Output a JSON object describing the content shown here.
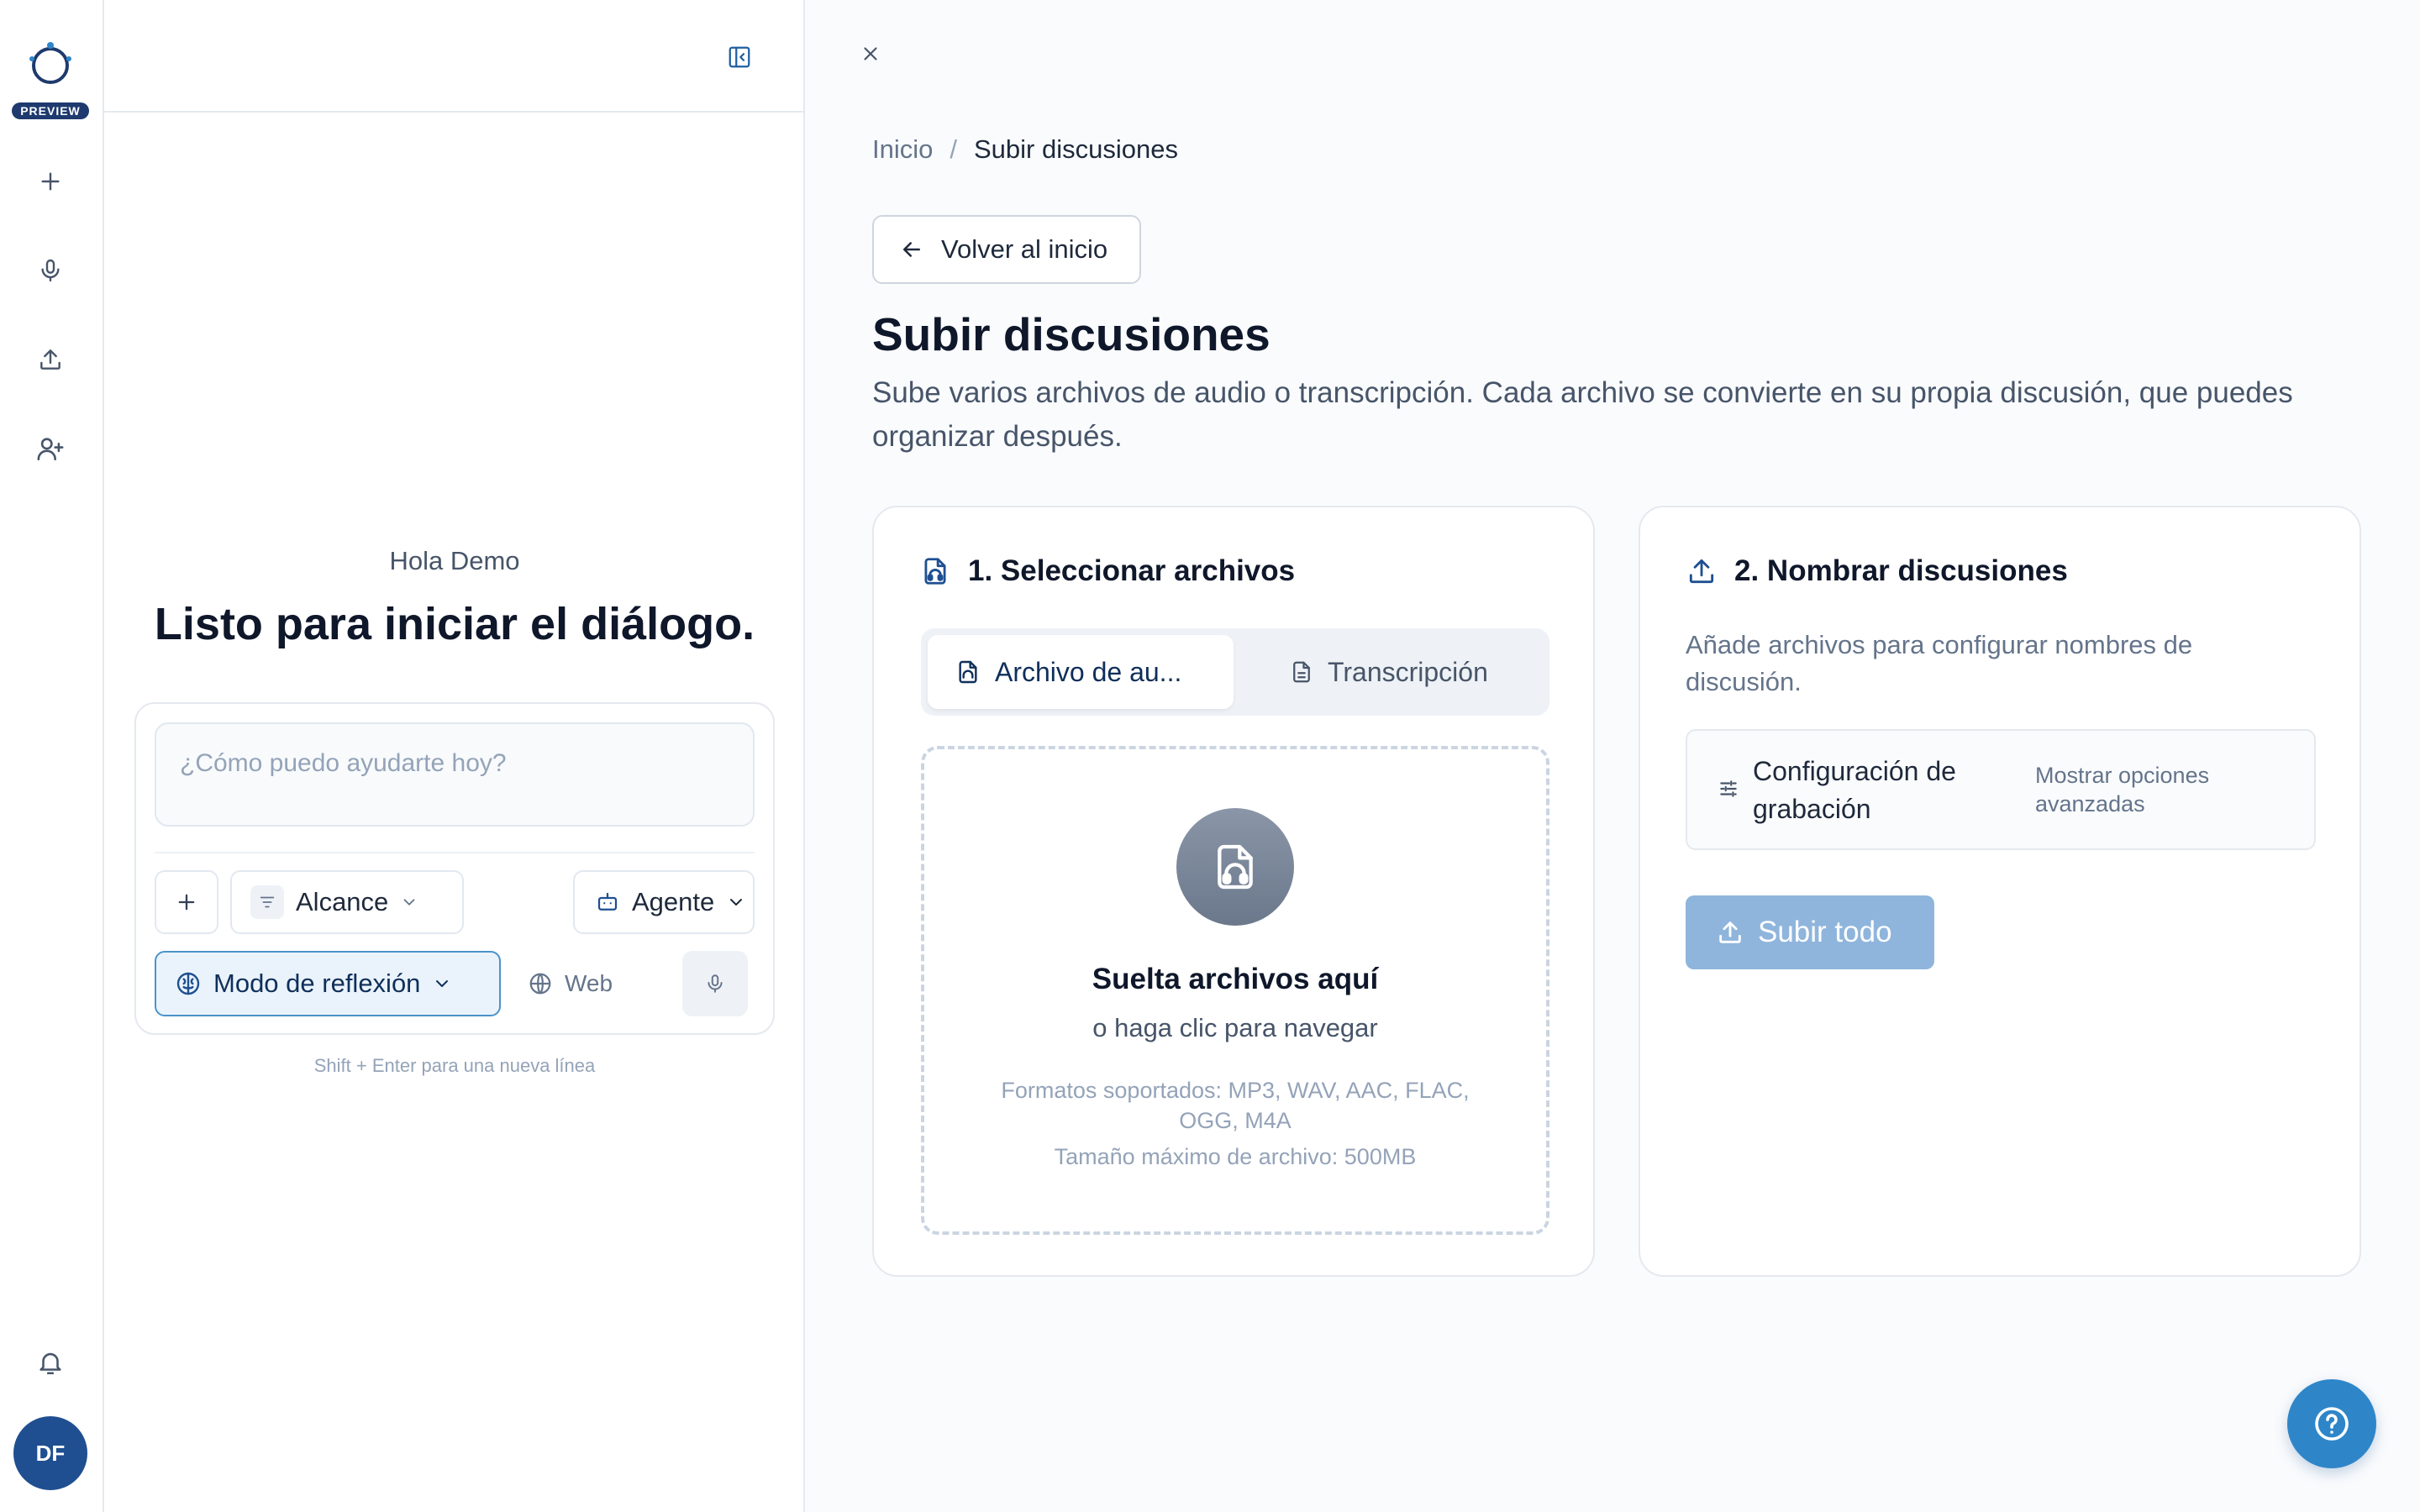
{
  "rail": {
    "badge": "PREVIEW",
    "items": [
      {
        "icon": "plus-icon"
      },
      {
        "icon": "microphone-icon"
      },
      {
        "icon": "upload-icon"
      },
      {
        "icon": "add-user-icon"
      }
    ],
    "notifications_icon": "bell-icon",
    "avatar_initials": "DF"
  },
  "chat": {
    "greeting": "Hola Demo",
    "title": "Listo para iniciar el diálogo.",
    "input_placeholder": "¿Cómo puedo ayudarte hoy?",
    "scope_label": "Alcance",
    "agent_label": "Agente",
    "think_label": "Modo de reflexión",
    "web_label": "Web",
    "hint": "Shift + Enter para una nueva línea"
  },
  "main": {
    "breadcrumb": {
      "home": "Inicio",
      "separator": "/",
      "current": "Subir discusiones"
    },
    "back_label": "Volver al inicio",
    "title": "Subir discusiones",
    "description": "Sube varios archivos de audio o transcripción. Cada archivo se convierte en su propia discusión, que puedes organizar después.",
    "step1": {
      "title": "1. Seleccionar archivos",
      "tabs": [
        {
          "label": "Archivo de au...",
          "active": true
        },
        {
          "label": "Transcripción",
          "active": false
        }
      ],
      "dropzone": {
        "title": "Suelta archivos aquí",
        "subtitle": "o haga clic para navegar",
        "formats": "Formatos soportados: MP3, WAV, AAC, FLAC, OGG, M4A",
        "max_size": "Tamaño máximo de archivo: 500MB"
      }
    },
    "step2": {
      "title": "2. Nombrar discusiones",
      "description": "Añade archivos para configurar nombres de discusión.",
      "config_label": "Configuración de grabación",
      "config_advanced": "Mostrar opciones avanzadas",
      "upload_all_label": "Subir todo"
    }
  },
  "colors": {
    "brand": "#1f4f91",
    "accent": "#2e86c9",
    "upload_disabled": "#8fb5dc",
    "think_active_border": "#4b93c9"
  }
}
